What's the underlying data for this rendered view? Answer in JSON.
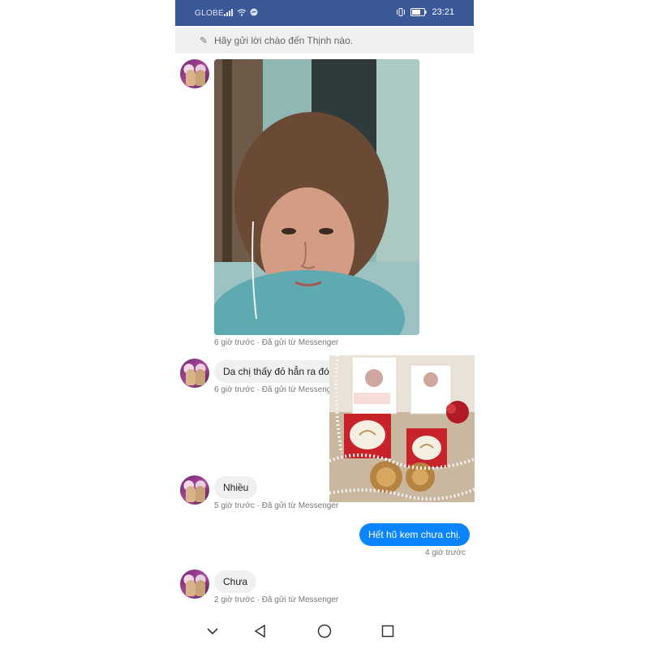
{
  "status_bar": {
    "carrier": "GLOBE",
    "time": "23:21",
    "icons": [
      "signal-icon",
      "wifi-icon",
      "messenger-icon",
      "vibrate-icon",
      "battery-icon"
    ]
  },
  "greeting": {
    "placeholder": "Hãy gửi lời chào đến Thịnh nào.",
    "icon": "pencil-icon"
  },
  "messages": [
    {
      "type": "image",
      "direction": "incoming",
      "image": "selfie-photo",
      "meta": "6 giờ trước · Đã gửi từ Messenger"
    },
    {
      "type": "text",
      "direction": "incoming",
      "text": "Da chị thấy đỏ hẳn ra đó",
      "meta": "6 giờ trước · Đã gửi từ Messenger"
    },
    {
      "type": "text",
      "direction": "incoming",
      "text": "Nhiều",
      "meta": "5 giờ trước · Đã gửi từ Messenger"
    },
    {
      "type": "text",
      "direction": "outgoing",
      "text": "Hết hũ kem chưa chị.",
      "meta": "4 giờ trước"
    },
    {
      "type": "text",
      "direction": "incoming",
      "text": "Chưa",
      "meta": "2 giờ trước · Đã gửi từ Messenger"
    }
  ],
  "overlay_image": "cream-product-photo",
  "nav_bar": {
    "buttons": [
      "chevron-down-icon",
      "back-triangle-icon",
      "home-circle-icon",
      "recents-square-icon"
    ]
  },
  "colors": {
    "status_bar": "#3b5998",
    "outgoing_bubble": "#0a84ff",
    "incoming_bubble": "#f1f0f0"
  }
}
